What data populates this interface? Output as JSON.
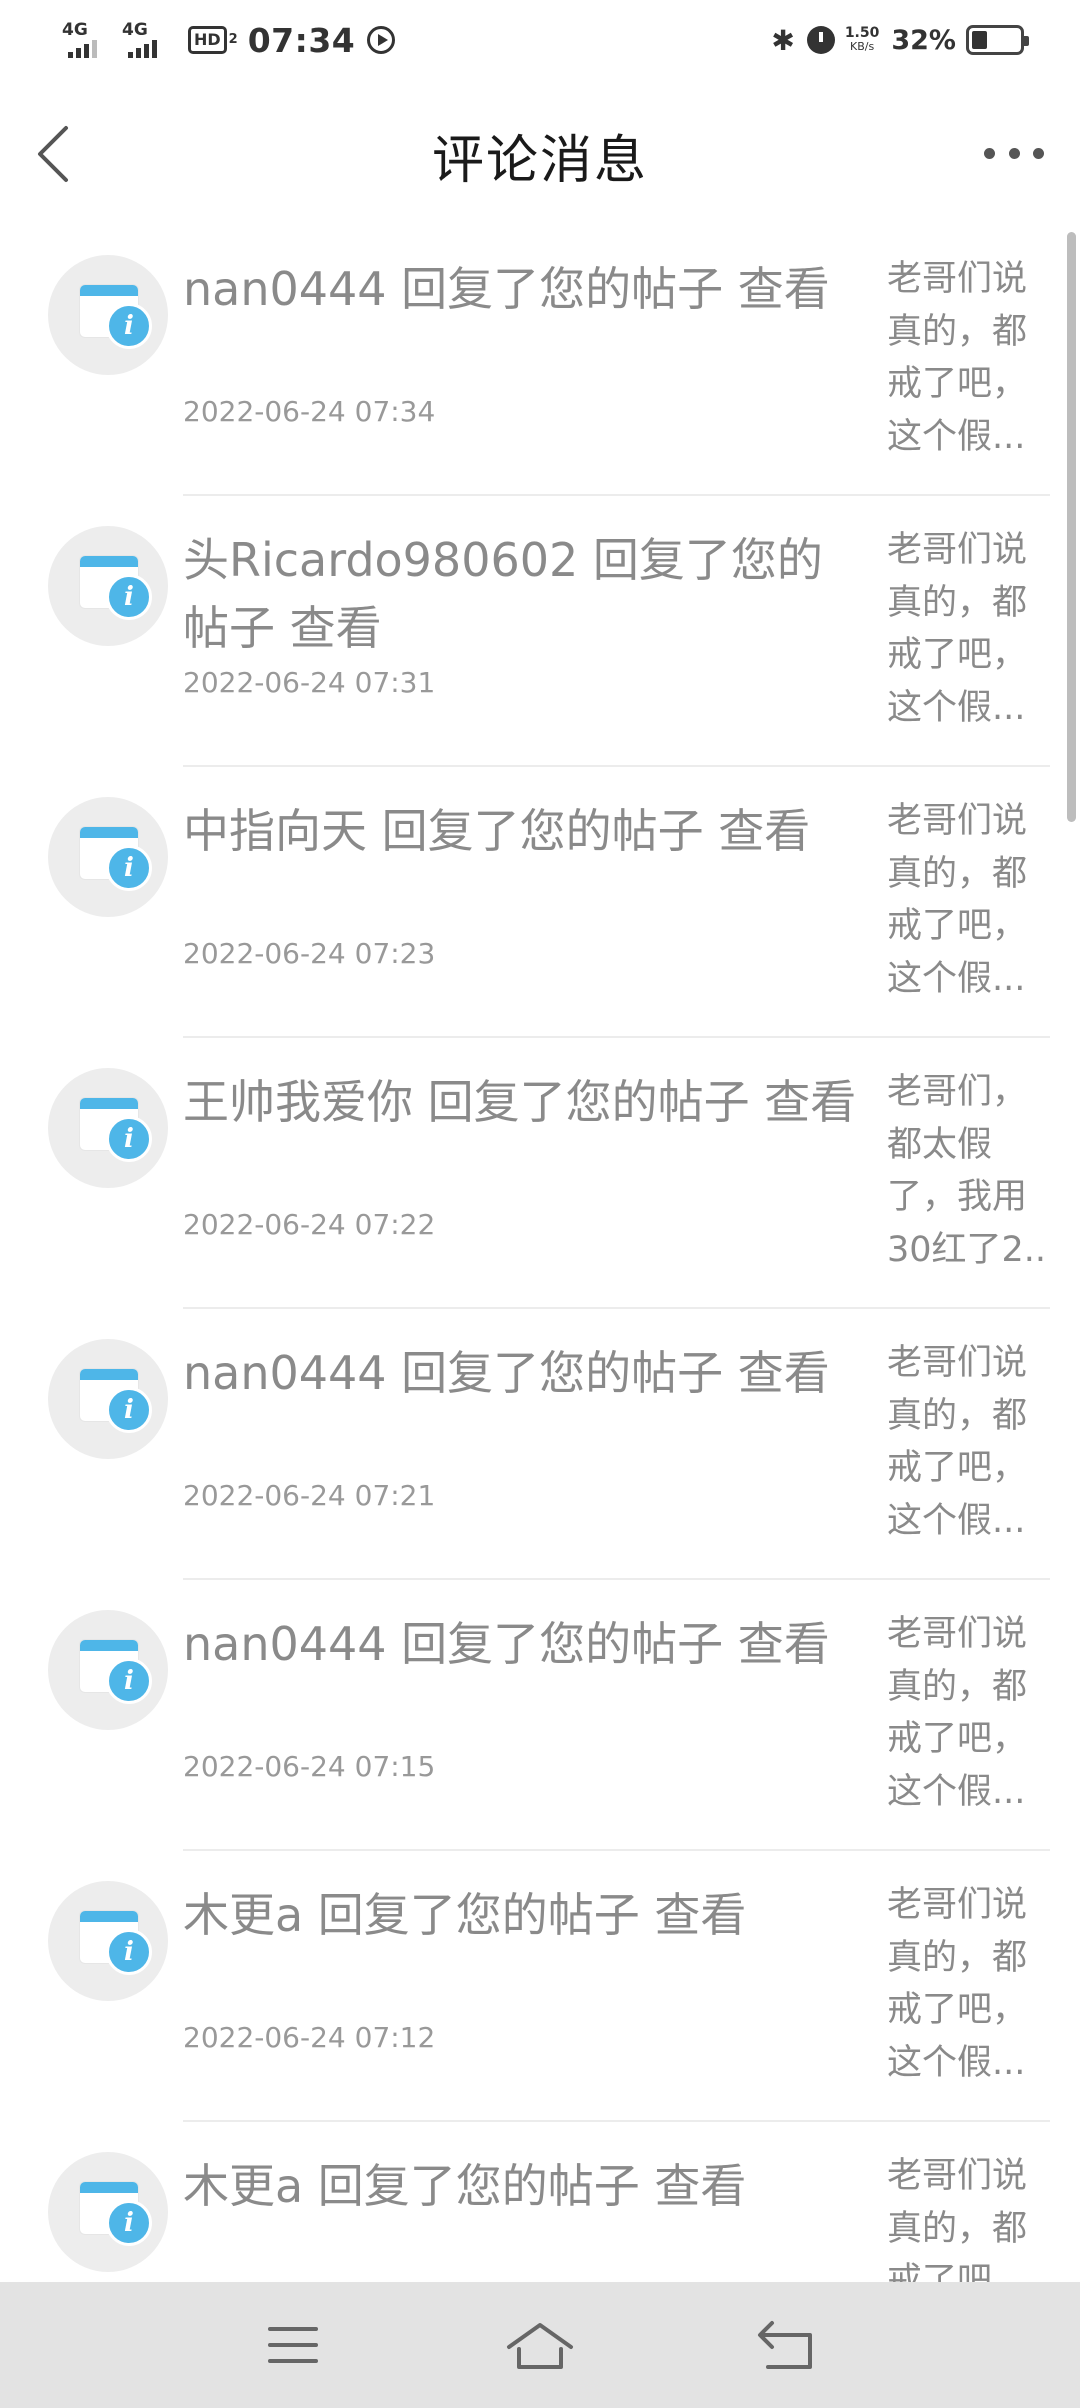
{
  "status_bar": {
    "network1": "4G",
    "network2": "4G",
    "hd_label": "HD",
    "hd_sub": "2",
    "time": "07:34",
    "speed_value": "1.50",
    "speed_unit": "KB/s",
    "battery_percent": "32%",
    "battery_level": 0.32
  },
  "header": {
    "title": "评论消息",
    "back_icon": "chevron-left-icon",
    "more_icon": "more-horizontal-icon"
  },
  "messages": [
    {
      "title": "nan0444 回复了您的帖子 查看",
      "time": "2022-06-24 07:34",
      "snippet": [
        "老哥们说",
        "真的，都",
        "戒了吧，",
        "这个假..."
      ]
    },
    {
      "title": "头Ricardo980602 回复了您的帖子 查看",
      "time": "2022-06-24 07:31",
      "snippet": [
        "老哥们说",
        "真的，都",
        "戒了吧，",
        "这个假..."
      ]
    },
    {
      "title": "中指向天 回复了您的帖子 查看",
      "time": "2022-06-24 07:23",
      "snippet": [
        "老哥们说",
        "真的，都",
        "戒了吧，",
        "这个假..."
      ]
    },
    {
      "title": "王帅我爱你 回复了您的帖子 查看",
      "time": "2022-06-24 07:22",
      "snippet": [
        "老哥们，",
        "都太假",
        "了，我用",
        "30红了2..."
      ]
    },
    {
      "title": "nan0444 回复了您的帖子 查看",
      "time": "2022-06-24 07:21",
      "snippet": [
        "老哥们说",
        "真的，都",
        "戒了吧，",
        "这个假..."
      ]
    },
    {
      "title": "nan0444 回复了您的帖子 查看",
      "time": "2022-06-24 07:15",
      "snippet": [
        "老哥们说",
        "真的，都",
        "戒了吧，",
        "这个假..."
      ]
    },
    {
      "title": "木更a 回复了您的帖子 查看",
      "time": "2022-06-24 07:12",
      "snippet": [
        "老哥们说",
        "真的，都",
        "戒了吧，",
        "这个假..."
      ]
    },
    {
      "title": "木更a 回复了您的帖子 查看",
      "time": "",
      "snippet": [
        "老哥们说",
        "真的，都",
        "戒了吧，",
        ""
      ]
    }
  ],
  "nav_bar": {
    "menu_icon": "menu-icon",
    "home_icon": "home-icon",
    "back_icon": "back-icon"
  }
}
